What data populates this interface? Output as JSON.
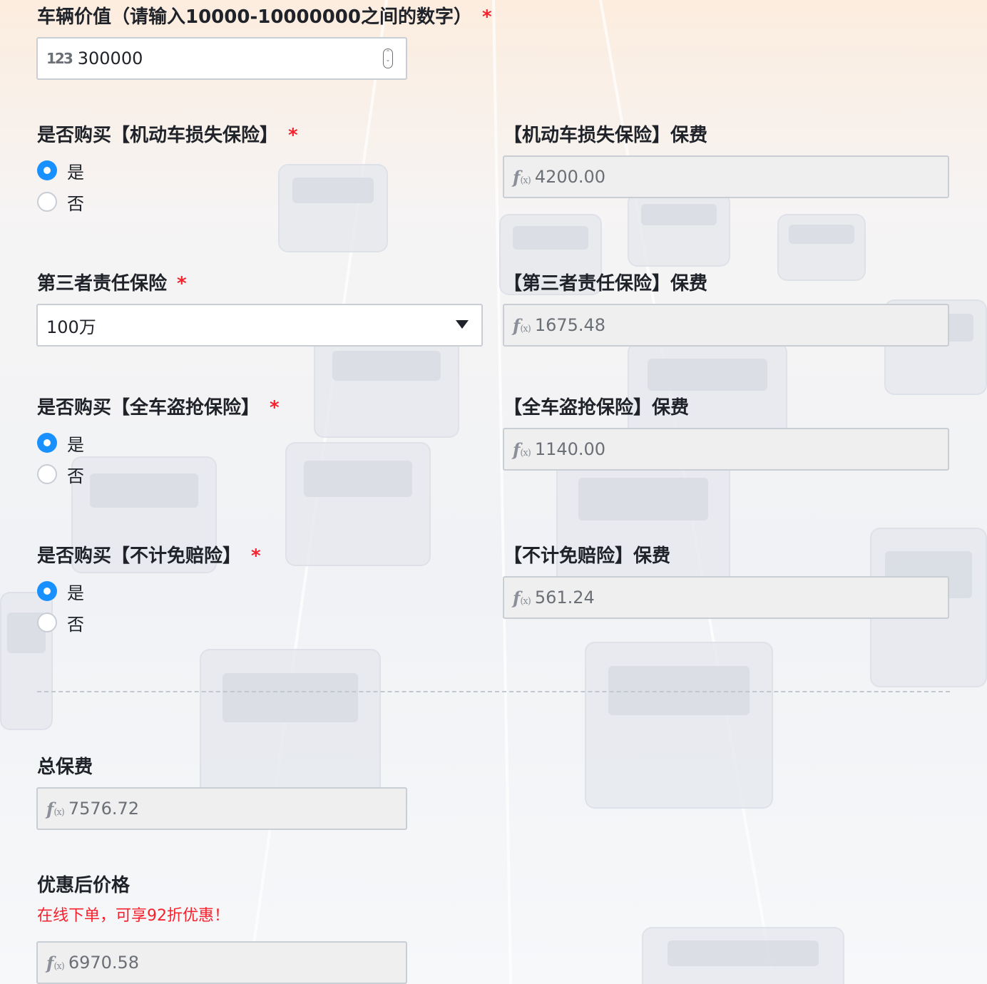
{
  "vehicle_value": {
    "label": "车辆价值（请输入10000-10000000之间的数字）",
    "required": "*",
    "icon": "123-number-icon",
    "icon_text": "123",
    "value": "300000"
  },
  "vehicle_damage": {
    "label": "是否购买【机动车损失保险】",
    "required": "*",
    "options": [
      "是",
      "否"
    ],
    "selected": "是",
    "premium_label": "【机动车损失保险】保费",
    "premium_value": "4200.00"
  },
  "third_party": {
    "label": "第三者责任保险",
    "required": "*",
    "selected_value": "100万",
    "premium_label": "【第三者责任保险】保费",
    "premium_value": "1675.48"
  },
  "theft": {
    "label": "是否购买【全车盗抢保险】",
    "required": "*",
    "options": [
      "是",
      "否"
    ],
    "selected": "是",
    "premium_label": "【全车盗抢保险】保费",
    "premium_value": "1140.00"
  },
  "deductible": {
    "label": "是否购买【不计免赔险】",
    "required": "*",
    "options": [
      "是",
      "否"
    ],
    "selected": "是",
    "premium_label": "【不计免赔险】保费",
    "premium_value": "561.24"
  },
  "total": {
    "label": "总保费",
    "value": "7576.72"
  },
  "discount": {
    "label": "优惠后价格",
    "promo": "在线下单，可享92折优惠！",
    "value": "6970.58"
  },
  "formula_icon": {
    "name": "fx-formula-icon",
    "f": "f",
    "x": "(x)"
  },
  "colors": {
    "accent": "#1890ff",
    "required": "#f5222d",
    "promo": "#f5222d"
  }
}
